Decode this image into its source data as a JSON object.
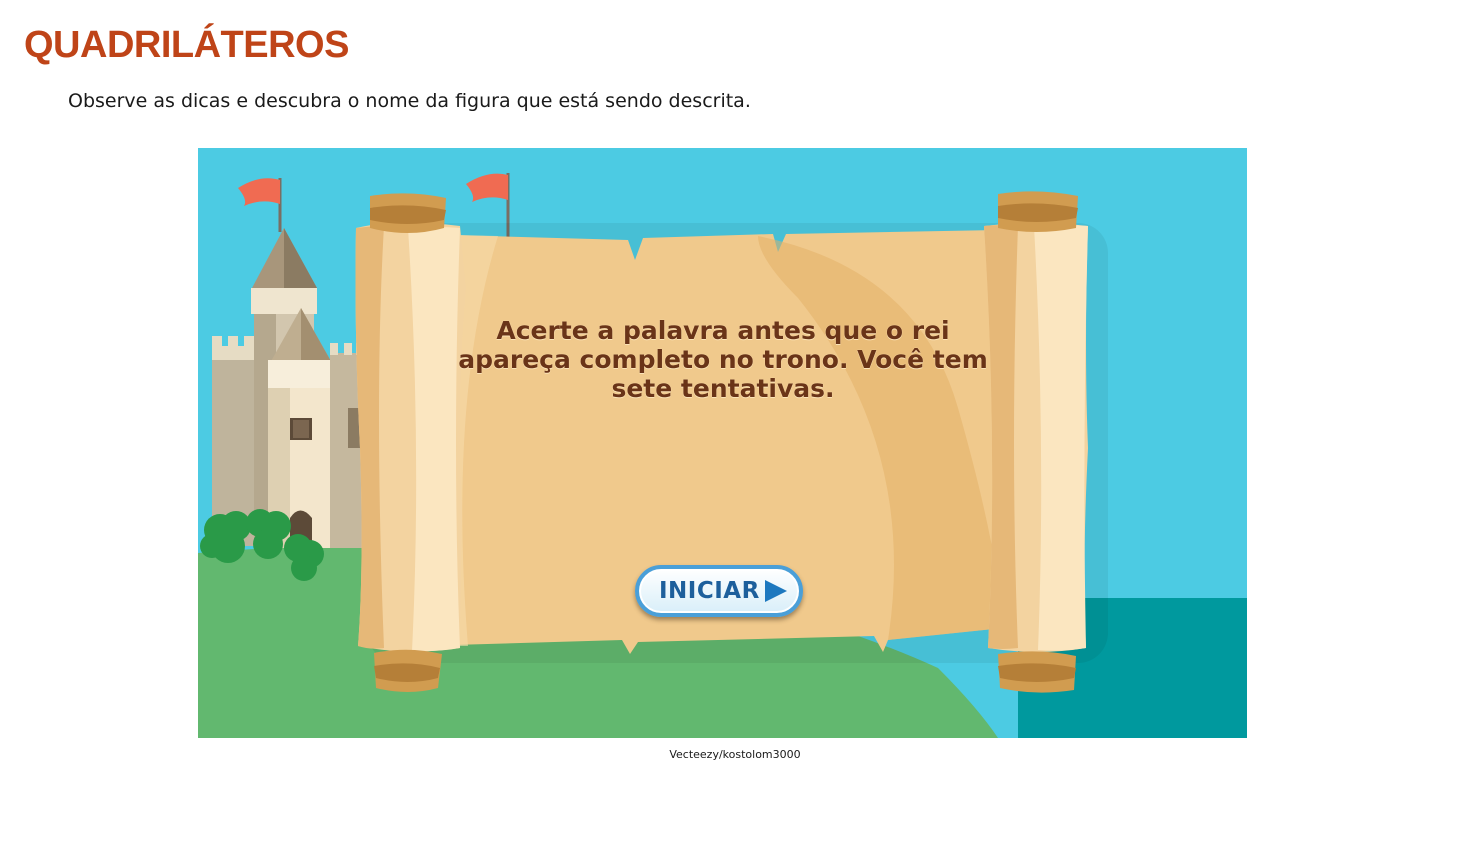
{
  "page": {
    "title": "QUADRILÁTEROS",
    "instruction": "Observe as dicas e descubra o nome da figura que está sendo descrita.",
    "credit": "Vecteezy/kostolom3000"
  },
  "game": {
    "scroll_message": "Acerte a palavra antes que o rei apareça completo no trono. Você tem sete tentativas.",
    "start_button_label": "INICIAR",
    "start_button_icon": "play-icon"
  },
  "colors": {
    "title": "#bf4418",
    "sky": "#4ccbe3",
    "grass": "#62b86f",
    "sea": "#00999e",
    "parchment": "#f0c98c",
    "message_text": "#6a3418",
    "button_text": "#1d5f9c",
    "flag": "#f06b52"
  }
}
